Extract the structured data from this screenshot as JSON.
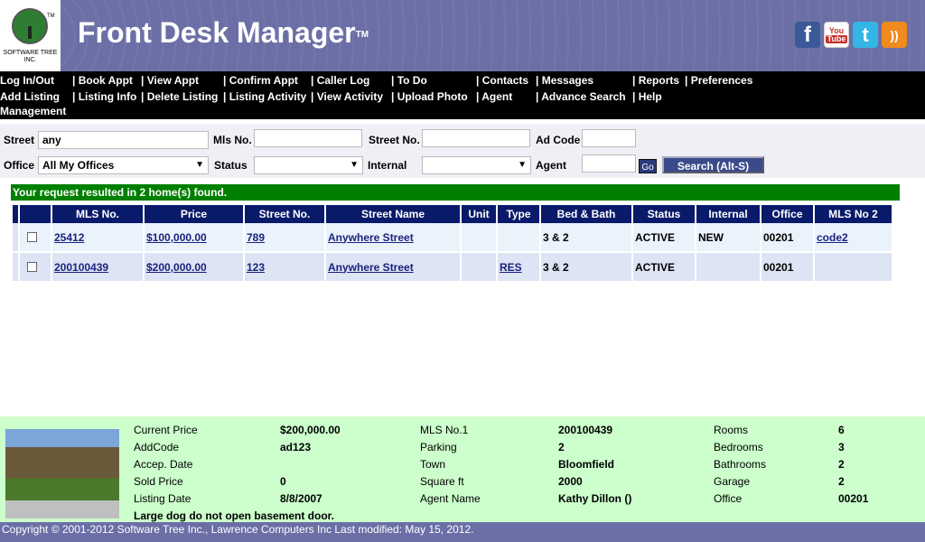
{
  "header": {
    "logo_text": "SOFTWARE TREE INC.",
    "logo_tm": "TM",
    "title": "Front Desk Manager",
    "title_tm": "TM",
    "social": {
      "facebook": "f",
      "youtube_top": "You",
      "youtube_bottom": "Tube",
      "twitter": "t",
      "rss": "))"
    }
  },
  "menu": {
    "row1": [
      "Log In/Out",
      "| Book Appt",
      "| View Appt",
      "| Confirm Appt",
      "| Caller Log",
      "| To Do",
      "| Contacts",
      "| Messages",
      "| Reports",
      "| Preferences"
    ],
    "row2": [
      "Add Listing",
      "| Listing Info",
      "| Delete Listing",
      "| Listing Activity",
      "| View Activity",
      "| Upload Photo",
      "| Agent",
      "| Advance Search",
      "| Help"
    ],
    "row3": [
      "Management"
    ]
  },
  "search": {
    "street_label": "Street",
    "street_value": "any",
    "mls_label": "Mls No.",
    "mls_value": "",
    "streetno_label": "Street No.",
    "streetno_value": "",
    "adcode_label": "Ad Code",
    "adcode_value": "",
    "office_label": "Office",
    "office_value": "All My Offices",
    "status_label": "Status",
    "status_value": "",
    "internal_label": "Internal",
    "internal_value": "",
    "agent_label": "Agent",
    "agent_value": "",
    "go_label": "Go",
    "search_label": "Search  (Alt-S)"
  },
  "results": {
    "message": "Your request resulted in 2 home(s) found.",
    "columns": [
      "",
      "MLS No.",
      "Price",
      "Street No.",
      "Street Name",
      "Unit",
      "Type",
      "Bed & Bath",
      "Status",
      "Internal",
      "Office",
      "MLS No 2"
    ],
    "rows": [
      {
        "mls": "25412",
        "price": "$100,000.00",
        "street_no": "789",
        "street_name": "Anywhere Street",
        "unit": "",
        "type": "",
        "bed_bath": "3 & 2",
        "status": "ACTIVE",
        "internal": "NEW",
        "office": "00201",
        "mls2": "code2"
      },
      {
        "mls": "200100439",
        "price": "$200,000.00",
        "street_no": "123",
        "street_name": "Anywhere Street",
        "unit": "",
        "type": "RES",
        "bed_bath": "3 & 2",
        "status": "ACTIVE",
        "internal": "",
        "office": "00201",
        "mls2": ""
      }
    ]
  },
  "detail": {
    "labels1": [
      "Current Price",
      "AddCode",
      "Accep. Date",
      "Sold Price",
      "Listing Date"
    ],
    "values1": [
      "$200,000.00",
      "ad123",
      "",
      "0",
      "8/8/2007"
    ],
    "labels2": [
      "MLS No.1",
      "Parking",
      "Town",
      "Square ft",
      "Agent Name"
    ],
    "values2": [
      "200100439",
      "2",
      "Bloomfield",
      "2000",
      "Kathy Dillon ()"
    ],
    "labels3": [
      "Rooms",
      "Bedrooms",
      "Bathrooms",
      "Garage",
      "Office"
    ],
    "values3": [
      "6",
      "3",
      "2",
      "2",
      "00201"
    ],
    "note": "Large dog do not open basement door."
  },
  "footer": {
    "text": "Copyright © 2001-2012 Software Tree Inc., Lawrence Computers Inc Last modified: May 15, 2012."
  },
  "colors": {
    "header": "#6b6fa6",
    "menu": "#000000",
    "result_bar": "#008000",
    "table_header": "#0a1a6a",
    "detail": "#ccffcc"
  }
}
